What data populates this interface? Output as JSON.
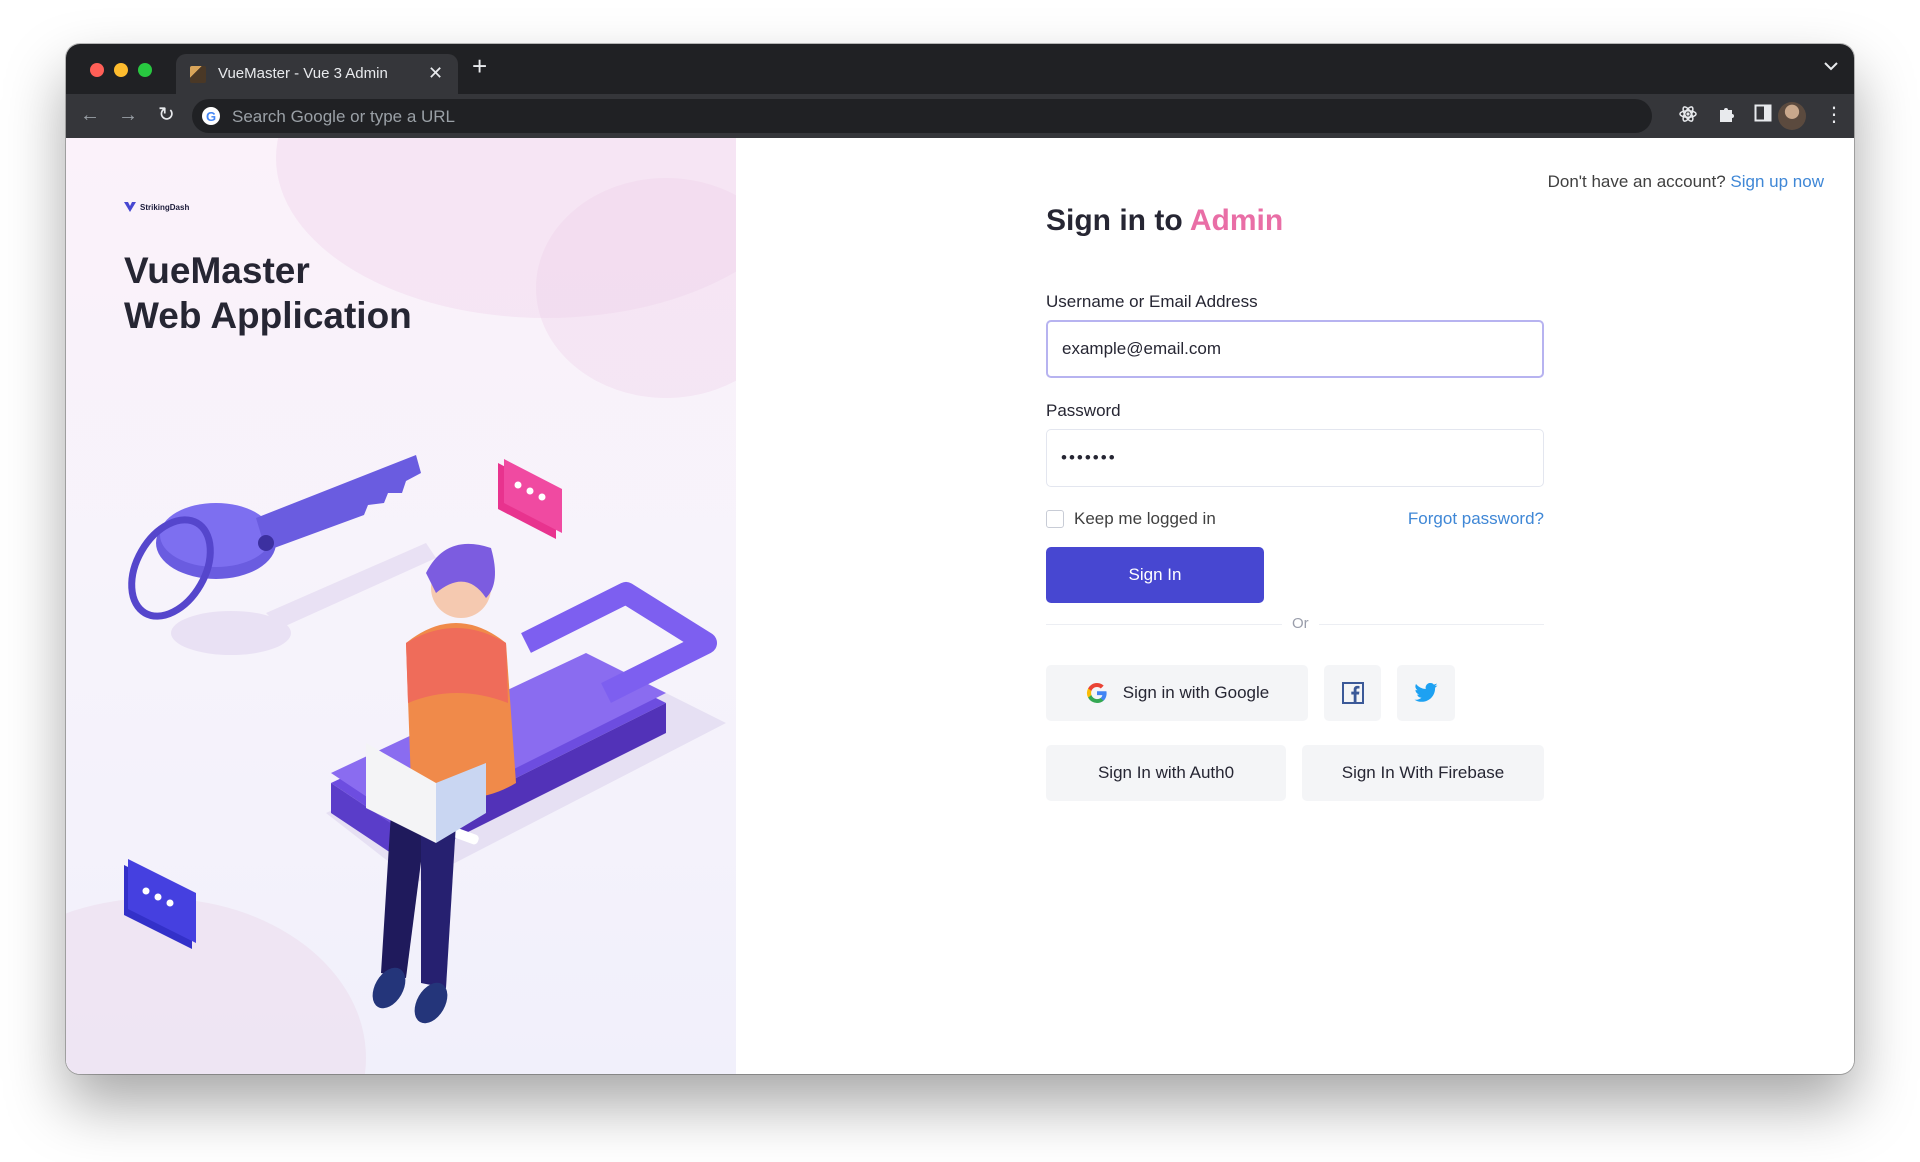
{
  "browser": {
    "tab_title": "VueMaster - Vue 3 Admin",
    "tab_close": "✕",
    "new_tab": "+",
    "tab_search": "⌄",
    "omnibox_placeholder": "Search Google or type a URL",
    "back": "←",
    "forward": "→",
    "reload": "↻",
    "menu": "⋮"
  },
  "brand": {
    "logo_text": "StrikingDash",
    "hero_line1": "VueMaster",
    "hero_line2": "Web Application"
  },
  "auth": {
    "signup_prompt": "Don't have an account?",
    "signup_link": "Sign up now",
    "title_prefix": "Sign in to",
    "title_accent": "Admin",
    "username_label": "Username or Email Address",
    "username_value": "example@email.com",
    "password_label": "Password",
    "password_value": "•••••••",
    "remember_label": "Keep me logged in",
    "forgot_link": "Forgot password?",
    "signin_button": "Sign In",
    "divider_text": "Or",
    "google_button": "Sign in with Google",
    "auth0_button": "Sign In with Auth0",
    "firebase_button": "Sign In With Firebase"
  },
  "colors": {
    "primary": "#4747d1",
    "accent": "#e96ea6",
    "link": "#3f87d6"
  }
}
